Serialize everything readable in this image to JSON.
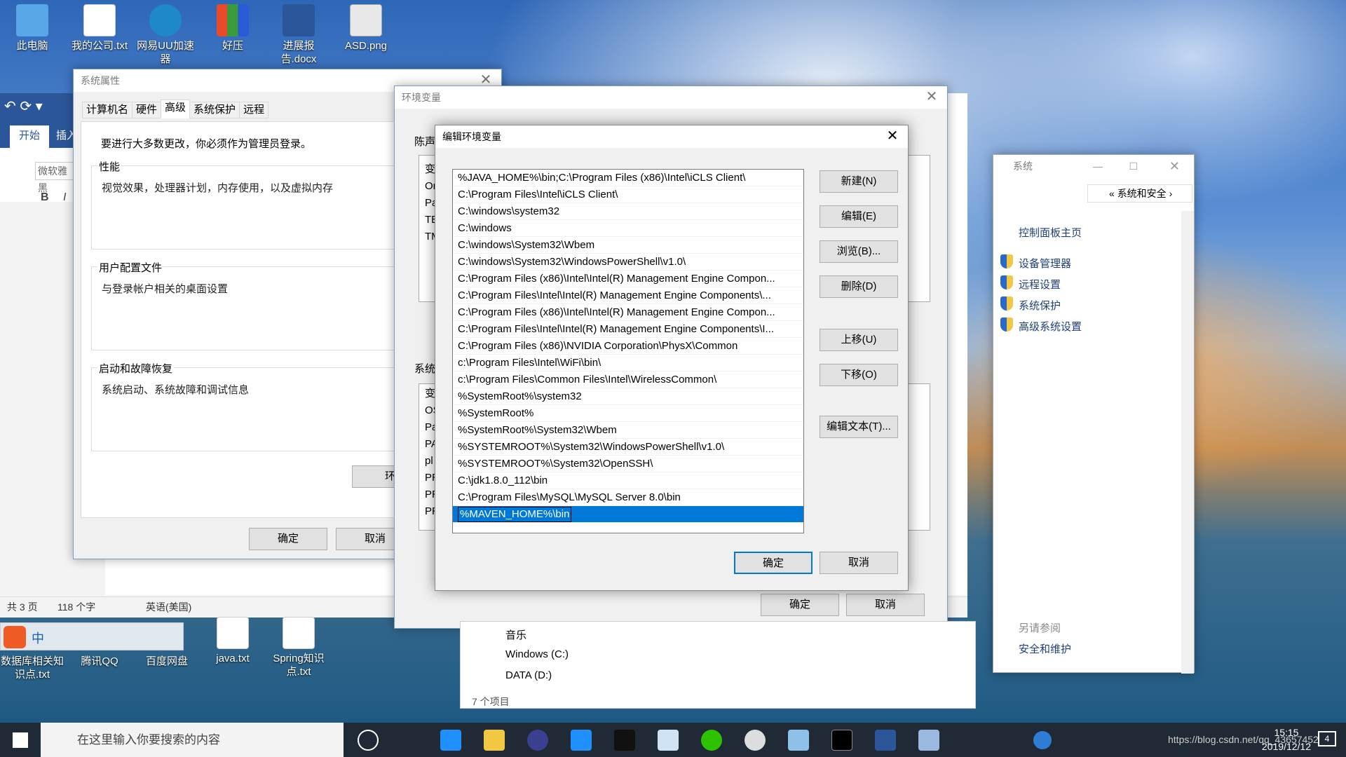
{
  "desktop": {
    "icons_top": [
      {
        "label": "此电脑",
        "color": "#58a6e8"
      },
      {
        "label": "我的公司.txt",
        "color": "#ffffff"
      },
      {
        "label": "网易UU加速器",
        "color": "#1e88c8"
      },
      {
        "label": "好压",
        "color": "#e84a2a"
      },
      {
        "label": "进展报告.docx",
        "color": "#2b579a"
      },
      {
        "label": "ASD.png",
        "color": "#e8e8e8"
      }
    ],
    "icons_bottom": [
      {
        "label": "数据库相关知识点.txt",
        "color": "#ffffff"
      },
      {
        "label": "腾讯QQ",
        "color": "#222222"
      },
      {
        "label": "百度网盘",
        "color": "#2e8ae6"
      },
      {
        "label": "java.txt",
        "color": "#ffffff"
      },
      {
        "label": "Spring知识点.txt",
        "color": "#ffffff"
      }
    ]
  },
  "word": {
    "tab_start": "开始",
    "tab_insert": "插入",
    "font_name": "微软雅黑",
    "bold": "B",
    "italic": "I",
    "status_pages": "共 3 页",
    "status_words": "118 个字",
    "status_lang": "英语(美国)"
  },
  "system_properties": {
    "title": "系统属性",
    "tabs": [
      "计算机名",
      "硬件",
      "高级",
      "系统保护",
      "远程"
    ],
    "active_tab": "高级",
    "admin_note": "要进行大多数更改，你必须作为管理员登录。",
    "perf_title": "性能",
    "perf_text": "视觉效果，处理器计划，内存使用，以及虚拟内存",
    "profile_title": "用户配置文件",
    "profile_text": "与登录帐户相关的桌面设置",
    "startup_title": "启动和故障恢复",
    "startup_text": "系统启动、系统故障和调试信息",
    "env_button": "环境变量(N)...",
    "ok": "确定",
    "cancel": "取消"
  },
  "env_vars": {
    "title": "环境变量",
    "user_section": "陈声",
    "user_list": [
      "变",
      "On",
      "Pa",
      "TE",
      "TM"
    ],
    "system_section": "系统",
    "system_list": [
      "变",
      "OS",
      "Pa",
      "PA",
      "pl",
      "PR",
      "PR",
      "PR"
    ],
    "ok": "确定",
    "cancel": "取消"
  },
  "edit_env": {
    "title": "编辑环境变量",
    "paths": [
      "%JAVA_HOME%\\bin;C:\\Program Files (x86)\\Intel\\iCLS Client\\",
      "C:\\Program Files\\Intel\\iCLS Client\\",
      "C:\\windows\\system32",
      "C:\\windows",
      "C:\\windows\\System32\\Wbem",
      "C:\\windows\\System32\\WindowsPowerShell\\v1.0\\",
      "C:\\Program Files (x86)\\Intel\\Intel(R) Management Engine Compon...",
      "C:\\Program Files\\Intel\\Intel(R) Management Engine Components\\...",
      "C:\\Program Files (x86)\\Intel\\Intel(R) Management Engine Compon...",
      "C:\\Program Files\\Intel\\Intel(R) Management Engine Components\\I...",
      "C:\\Program Files (x86)\\NVIDIA Corporation\\PhysX\\Common",
      "c:\\Program Files\\Intel\\WiFi\\bin\\",
      "c:\\Program Files\\Common Files\\Intel\\WirelessCommon\\",
      "%SystemRoot%\\system32",
      "%SystemRoot%",
      "%SystemRoot%\\System32\\Wbem",
      "%SYSTEMROOT%\\System32\\WindowsPowerShell\\v1.0\\",
      "%SYSTEMROOT%\\System32\\OpenSSH\\",
      "C:\\jdk1.8.0_112\\bin",
      "C:\\Program Files\\MySQL\\MySQL Server 8.0\\bin"
    ],
    "editing_value": "%MAVEN_HOME%\\bin",
    "buttons": {
      "new": "新建(N)",
      "edit": "编辑(E)",
      "browse": "浏览(B)...",
      "delete": "删除(D)",
      "move_up": "上移(U)",
      "move_down": "下移(O)",
      "edit_text": "编辑文本(T)..."
    },
    "ok": "确定",
    "cancel": "取消"
  },
  "system_window": {
    "title": "系统",
    "breadcrumb": "系统和安全",
    "home_link": "控制面板主页",
    "links": [
      "设备管理器",
      "远程设置",
      "系统保护",
      "高级系统设置"
    ],
    "see_also": "另请参阅",
    "see_also_link": "安全和维护"
  },
  "explorer": {
    "items": [
      "音乐",
      "Windows (C:)",
      "DATA (D:)"
    ],
    "count": "7 个项目"
  },
  "taskbar": {
    "search_placeholder": "在这里输入你要搜索的内容",
    "time": "15:15",
    "date": "2019/12/12",
    "watermark": "https://blog.csdn.net/qq_43657452",
    "notification_count": "4",
    "ime_lang": "中"
  }
}
